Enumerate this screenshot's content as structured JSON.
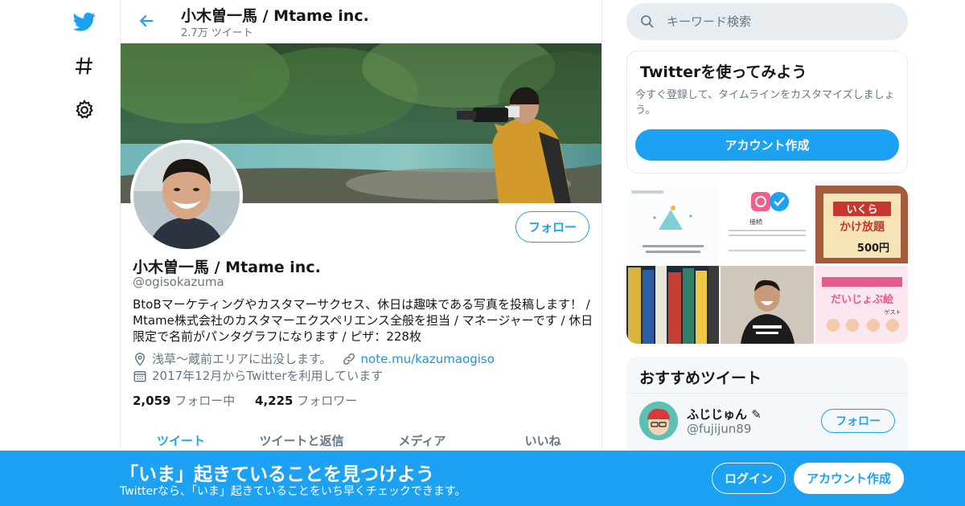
{
  "colors": {
    "accent": "#1da1f2",
    "text_primary": "#14171a",
    "text_secondary": "#657786",
    "border": "#e6ecf0"
  },
  "nav": {
    "items": [
      {
        "icon": "twitter-logo-icon"
      },
      {
        "icon": "hashtag-icon"
      },
      {
        "icon": "gear-icon"
      }
    ]
  },
  "header": {
    "title": "小木曽一馬 / Mtame inc.",
    "tweet_count": "2.7万 ツイート"
  },
  "profile": {
    "name": "小木曽一馬 / Mtame inc.",
    "handle": "@ogisokazuma",
    "bio": "BtoBマーケティングやカスタマーサクセス、休日は趣味である写真を投稿します！ / Mtame株式会社のカスタマーエクスペリエンス全般を担当 / マネージャーです / 休日限定で名前がパンタグラフになります / ピザ：228枚",
    "location": "浅草〜蔵前エリアに出没します。",
    "website": "note.mu/kazumaogiso",
    "joined": "2017年12月からTwitterを利用しています",
    "following_count": "2,059",
    "following_label": "フォロー中",
    "followers_count": "4,225",
    "followers_label": "フォロワー",
    "follow_label": "フォロー"
  },
  "tabs": [
    {
      "label": "ツイート"
    },
    {
      "label": "ツイートと返信"
    },
    {
      "label": "メディア"
    },
    {
      "label": "いいね"
    }
  ],
  "search": {
    "placeholder": "キーワード検索"
  },
  "signup_card": {
    "title": "Twitterを使ってみよう",
    "description": "今すぐ登録して、タイムラインをカスタマイズしましょう。",
    "button": "アカウント作成"
  },
  "media_texts": {
    "cell3_line1": "いくら",
    "cell3_line2": "かけ放題",
    "cell3_price": "500円",
    "cell6_title": "だいじょぶ絵",
    "cell6_sub": "ゲスト",
    "cell2_label": "接続"
  },
  "recommended": {
    "title": "おすすめツイート",
    "name": "ふじじゅん",
    "handle": "@fujijun89",
    "follow_label": "フォロー"
  },
  "bottom_bar": {
    "title": "「いま」起きていることを見つけよう",
    "subtitle": "Twitterなら、「いま」起きていることをいち早くチェックできます。",
    "login": "ログイン",
    "signup": "アカウント作成"
  }
}
